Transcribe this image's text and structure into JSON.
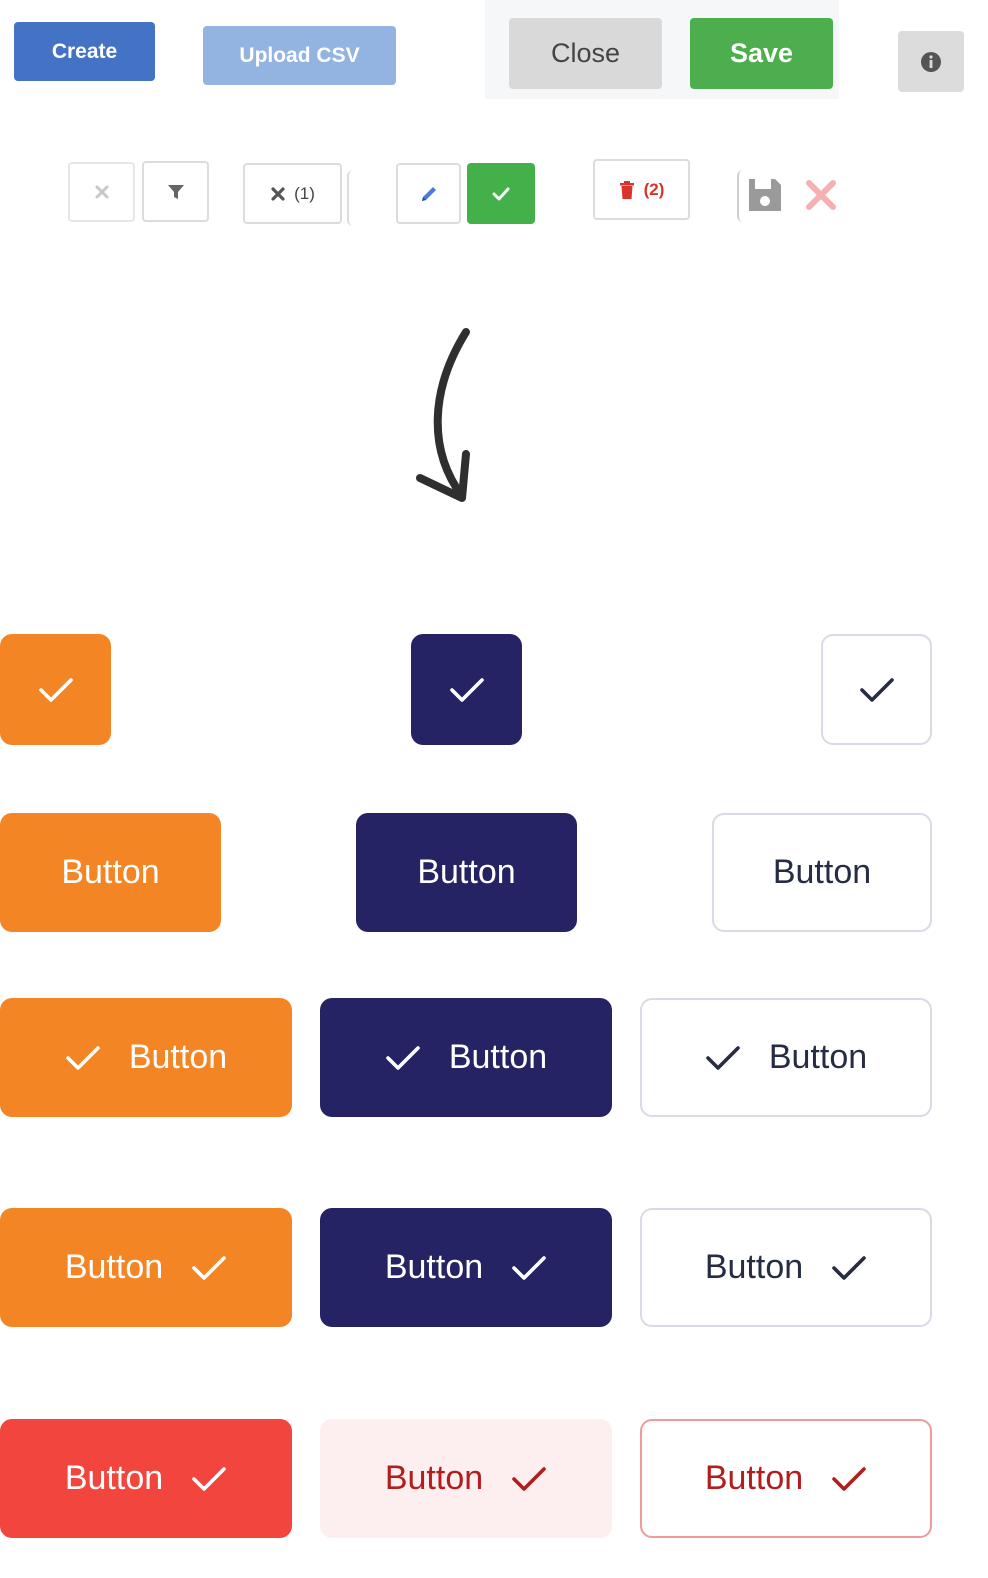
{
  "top_bar": {
    "create_label": "Create",
    "upload_label": "Upload CSV",
    "close_label": "Close",
    "save_label": "Save",
    "info_icon": "info-circle-icon"
  },
  "small_controls": {
    "clear_icon": "close-icon",
    "filter_icon": "filter-icon",
    "clear_filters_label": "(1)",
    "edit_icon": "pencil-icon",
    "confirm_icon": "check-icon",
    "delete_label": "(2)",
    "save_icon": "floppy-disk-icon",
    "cancel_icon": "close-icon"
  },
  "arrow_icon": "curved-arrow-down-icon",
  "variants": {
    "button_label": "Button",
    "check_icon": "check-icon"
  },
  "colors": {
    "orange": "#f48524",
    "navy": "#252363",
    "outline_text": "#252c43",
    "red": "#f2453d",
    "soft_red_bg": "#fdefef",
    "red_text": "#b21e1e",
    "legacy_blue": "#4472c4",
    "legacy_light_blue": "#93b3e0",
    "legacy_green": "#4cae4c",
    "legacy_gray": "#d9d9d9"
  }
}
